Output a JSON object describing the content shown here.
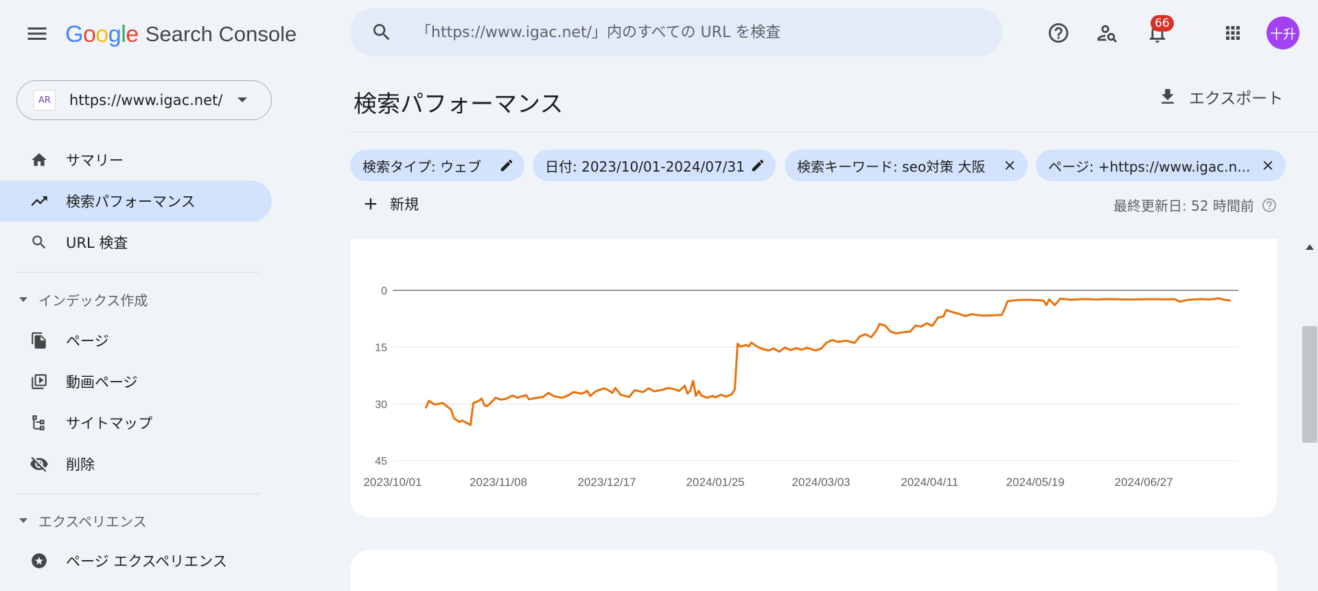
{
  "header": {
    "brand_google": "Google",
    "brand_product": "Search Console",
    "search_placeholder": "「https://www.igac.net/」内のすべての URL を検査",
    "notification_count": "66",
    "avatar_text": "十升"
  },
  "sidebar": {
    "property_logo_text": "AR",
    "property_url": "https://www.igac.net/",
    "items": [
      {
        "label": "サマリー",
        "icon": "home-icon"
      },
      {
        "label": "検索パフォーマンス",
        "icon": "trending-up-icon"
      },
      {
        "label": "URL 検査",
        "icon": "search-icon"
      }
    ],
    "section_index": "インデックス作成",
    "index_items": [
      {
        "label": "ページ",
        "icon": "pages-icon"
      },
      {
        "label": "動画ページ",
        "icon": "video-pages-icon"
      },
      {
        "label": "サイトマップ",
        "icon": "sitemap-icon"
      },
      {
        "label": "削除",
        "icon": "removals-icon"
      }
    ],
    "section_experience": "エクスペリエンス",
    "experience_items": [
      {
        "label": "ページ エクスペリエンス",
        "icon": "page-experience-icon"
      }
    ]
  },
  "main": {
    "title": "検索パフォーマンス",
    "export_label": "エクスポート",
    "filters": [
      {
        "label": "検索タイプ: ウェブ",
        "action": "edit"
      },
      {
        "label": "日付: 2023/10/01-2024/07/31",
        "action": "edit"
      },
      {
        "label": "検索キーワード: seo対策 大阪",
        "action": "remove"
      },
      {
        "label": "ページ: +https://www.igac.n...",
        "action": "remove"
      }
    ],
    "new_label": "新規",
    "last_updated": "最終更新日: 52 時間前"
  },
  "colors": {
    "background": "#f0f4f9",
    "accent_chip": "#d3e3fd",
    "series_position": "#e8710a",
    "badge": "#d93025",
    "avatar": "#a142f4"
  },
  "chart_data": {
    "type": "line",
    "title": "",
    "xlabel": "",
    "ylabel": "",
    "y_inverted": true,
    "ylim": [
      0,
      45
    ],
    "yticks": [
      0,
      15,
      30,
      45
    ],
    "xtick_labels": [
      "2023/10/01",
      "2023/11/08",
      "2023/12/17",
      "2024/01/25",
      "2024/03/03",
      "2024/04/11",
      "2024/05/19",
      "2024/06/27"
    ],
    "x_start": "2023/10/01",
    "x_end": "2024/07/31",
    "grid": true,
    "series": [
      {
        "color": "#e8710a",
        "points": [
          [
            "2023/10/13",
            31
          ],
          [
            "2023/10/14",
            29.2
          ],
          [
            "2023/10/16",
            30.2
          ],
          [
            "2023/10/19",
            29.8
          ],
          [
            "2023/10/22",
            31.5
          ],
          [
            "2023/10/23",
            33.8
          ],
          [
            "2023/10/25",
            34.8
          ],
          [
            "2023/10/26",
            34.4
          ],
          [
            "2023/10/28",
            35.2
          ],
          [
            "2023/10/29",
            35.6
          ],
          [
            "2023/10/30",
            29.8
          ],
          [
            "2023/11/01",
            29.2
          ],
          [
            "2023/11/02",
            28.6
          ],
          [
            "2023/11/03",
            30.4
          ],
          [
            "2023/11/04",
            30.6
          ],
          [
            "2023/11/06",
            29.2
          ],
          [
            "2023/11/07",
            28.4
          ],
          [
            "2023/11/09",
            28.9
          ],
          [
            "2023/11/11",
            28.6
          ],
          [
            "2023/11/13",
            27.8
          ],
          [
            "2023/11/15",
            28.4
          ],
          [
            "2023/11/16",
            28.1
          ],
          [
            "2023/11/18",
            27.7
          ],
          [
            "2023/11/19",
            28.8
          ],
          [
            "2023/11/21",
            28.5
          ],
          [
            "2023/11/24",
            28.2
          ],
          [
            "2023/11/26",
            27.1
          ],
          [
            "2023/11/28",
            28.0
          ],
          [
            "2023/12/01",
            28.4
          ],
          [
            "2023/12/03",
            27.8
          ],
          [
            "2023/12/05",
            26.9
          ],
          [
            "2023/12/08",
            27.3
          ],
          [
            "2023/12/10",
            26.6
          ],
          [
            "2023/12/11",
            27.9
          ],
          [
            "2023/12/13",
            26.7
          ],
          [
            "2023/12/16",
            25.9
          ],
          [
            "2023/12/17",
            26.2
          ],
          [
            "2023/12/19",
            27.1
          ],
          [
            "2023/12/20",
            25.8
          ],
          [
            "2023/12/22",
            27.6
          ],
          [
            "2023/12/25",
            28.2
          ],
          [
            "2023/12/27",
            26.4
          ],
          [
            "2023/12/30",
            26.9
          ],
          [
            "2024/01/01",
            25.9
          ],
          [
            "2024/01/03",
            26.7
          ],
          [
            "2024/01/06",
            26.3
          ],
          [
            "2024/01/08",
            25.8
          ],
          [
            "2024/01/10",
            26.1
          ],
          [
            "2024/01/12",
            26.6
          ],
          [
            "2024/01/14",
            25.2
          ],
          [
            "2024/01/15",
            27.3
          ],
          [
            "2024/01/16",
            26.5
          ],
          [
            "2024/01/17",
            23.9
          ],
          [
            "2024/01/18",
            27.9
          ],
          [
            "2024/01/19",
            26.6
          ],
          [
            "2024/01/20",
            27.8
          ],
          [
            "2024/01/22",
            28.4
          ],
          [
            "2024/01/24",
            27.9
          ],
          [
            "2024/01/25",
            28.3
          ],
          [
            "2024/01/27",
            27.6
          ],
          [
            "2024/01/29",
            28.1
          ],
          [
            "2024/01/31",
            27.4
          ],
          [
            "2024/02/01",
            26.1
          ],
          [
            "2024/02/02",
            14.1
          ],
          [
            "2024/02/03",
            14.9
          ],
          [
            "2024/02/05",
            14.4
          ],
          [
            "2024/02/06",
            14.8
          ],
          [
            "2024/02/07",
            13.8
          ],
          [
            "2024/02/09",
            14.9
          ],
          [
            "2024/02/11",
            15.5
          ],
          [
            "2024/02/13",
            15.9
          ],
          [
            "2024/02/15",
            15.4
          ],
          [
            "2024/02/17",
            16.2
          ],
          [
            "2024/02/19",
            15.1
          ],
          [
            "2024/02/21",
            15.8
          ],
          [
            "2024/02/23",
            15.3
          ],
          [
            "2024/02/25",
            15.7
          ],
          [
            "2024/02/27",
            15.2
          ],
          [
            "2024/03/01",
            15.9
          ],
          [
            "2024/03/03",
            15.4
          ],
          [
            "2024/03/05",
            13.8
          ],
          [
            "2024/03/07",
            13.1
          ],
          [
            "2024/03/09",
            13.6
          ],
          [
            "2024/03/12",
            13.3
          ],
          [
            "2024/03/15",
            13.9
          ],
          [
            "2024/03/17",
            12.2
          ],
          [
            "2024/03/19",
            11.6
          ],
          [
            "2024/03/21",
            12.4
          ],
          [
            "2024/03/23",
            10.5
          ],
          [
            "2024/03/24",
            8.9
          ],
          [
            "2024/03/26",
            9.3
          ],
          [
            "2024/03/28",
            10.9
          ],
          [
            "2024/03/30",
            11.4
          ],
          [
            "2024/04/01",
            11.1
          ],
          [
            "2024/04/04",
            10.9
          ],
          [
            "2024/04/06",
            9.3
          ],
          [
            "2024/04/08",
            9.6
          ],
          [
            "2024/04/10",
            8.7
          ],
          [
            "2024/04/12",
            9.4
          ],
          [
            "2024/04/14",
            7.2
          ],
          [
            "2024/04/16",
            6.9
          ],
          [
            "2024/04/17",
            5.2
          ],
          [
            "2024/04/19",
            5.7
          ],
          [
            "2024/04/21",
            6.1
          ],
          [
            "2024/04/24",
            6.8
          ],
          [
            "2024/04/26",
            6.3
          ],
          [
            "2024/04/30",
            6.7
          ],
          [
            "2024/05/04",
            6.6
          ],
          [
            "2024/05/07",
            6.5
          ],
          [
            "2024/05/08",
            4.8
          ],
          [
            "2024/05/09",
            2.9
          ],
          [
            "2024/05/12",
            2.6
          ],
          [
            "2024/05/16",
            2.5
          ],
          [
            "2024/05/19",
            2.6
          ],
          [
            "2024/05/22",
            2.7
          ],
          [
            "2024/05/23",
            3.9
          ],
          [
            "2024/05/24",
            2.4
          ],
          [
            "2024/05/26",
            3.9
          ],
          [
            "2024/05/28",
            2.2
          ],
          [
            "2024/06/01",
            2.5
          ],
          [
            "2024/06/05",
            2.3
          ],
          [
            "2024/06/10",
            2.4
          ],
          [
            "2024/06/15",
            2.3
          ],
          [
            "2024/06/20",
            2.4
          ],
          [
            "2024/06/25",
            2.4
          ],
          [
            "2024/06/30",
            2.3
          ],
          [
            "2024/07/05",
            2.4
          ],
          [
            "2024/07/08",
            2.3
          ],
          [
            "2024/07/10",
            3.0
          ],
          [
            "2024/07/13",
            2.5
          ],
          [
            "2024/07/17",
            2.3
          ],
          [
            "2024/07/21",
            2.4
          ],
          [
            "2024/07/24",
            2.1
          ],
          [
            "2024/07/26",
            2.5
          ],
          [
            "2024/07/28",
            2.7
          ]
        ]
      }
    ]
  }
}
